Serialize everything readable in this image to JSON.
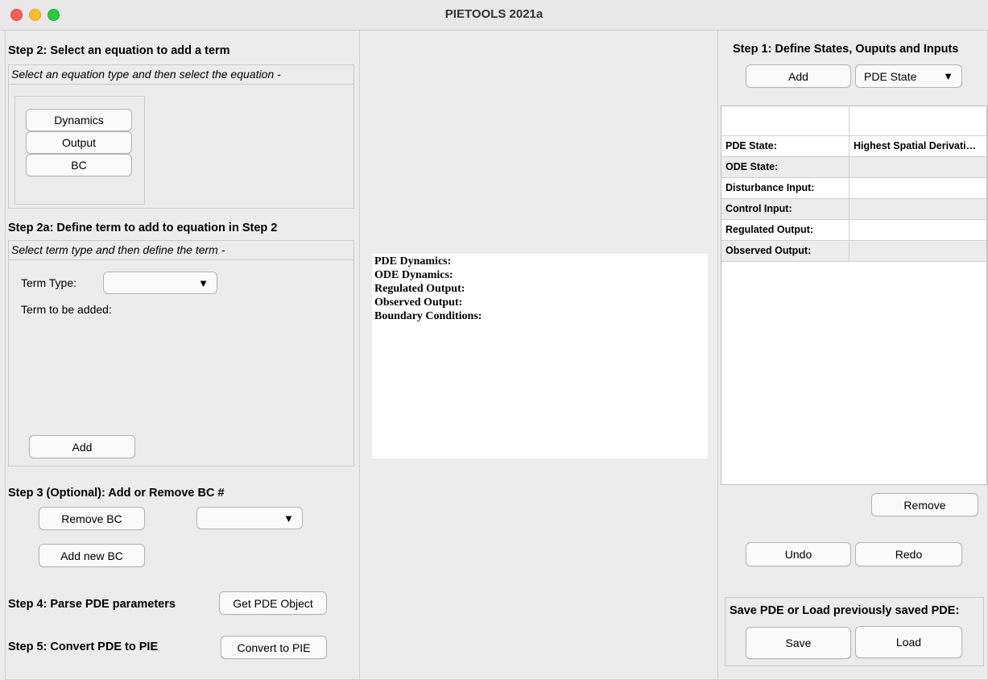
{
  "window": {
    "title": "PIETOOLS 2021a"
  },
  "left": {
    "step2": {
      "heading": "Step 2: Select an equation to add a term",
      "subtitle": "Select an equation type and then select the equation -",
      "buttons": {
        "dynamics": "Dynamics",
        "output": "Output",
        "bc": "BC"
      }
    },
    "step2a": {
      "heading": "Step 2a: Define term to add to equation in Step 2",
      "subtitle": "Select term type and then define the term -",
      "term_type_label": "Term Type:",
      "term_type_value": "",
      "term_to_add_label": "Term to be added:",
      "add_button": "Add"
    },
    "step3": {
      "heading": "Step 3 (Optional): Add or Remove BC #",
      "remove_button": "Remove BC",
      "bc_select_value": "",
      "add_new_button": "Add new BC"
    },
    "step4": {
      "label": "Step 4: Parse PDE parameters",
      "button": "Get PDE Object"
    },
    "step5": {
      "label": "Step 5: Convert PDE to PIE",
      "button": "Convert to PIE"
    }
  },
  "middle": {
    "summary_lines": [
      "PDE Dynamics:",
      "ODE Dynamics:",
      "Regulated Output:",
      "Observed Output:",
      "Boundary Conditions:"
    ]
  },
  "right": {
    "step1": {
      "heading": "Step 1: Define States, Ouputs and Inputs",
      "add_button": "Add",
      "type_select_value": "PDE State"
    },
    "table": {
      "header": [
        "",
        ""
      ],
      "rows": [
        [
          "PDE State:",
          "Highest Spatial Derivati…"
        ],
        [
          "ODE State:",
          ""
        ],
        [
          "Disturbance Input:",
          ""
        ],
        [
          "Control Input:",
          ""
        ],
        [
          "Regulated Output:",
          ""
        ],
        [
          "Observed Output:",
          ""
        ]
      ]
    },
    "remove_button": "Remove",
    "undo_button": "Undo",
    "redo_button": "Redo",
    "save_panel": {
      "heading": "Save PDE or Load previously saved PDE:",
      "save_button": "Save",
      "load_button": "Load"
    }
  },
  "icons": {
    "dropdown": "▼"
  }
}
